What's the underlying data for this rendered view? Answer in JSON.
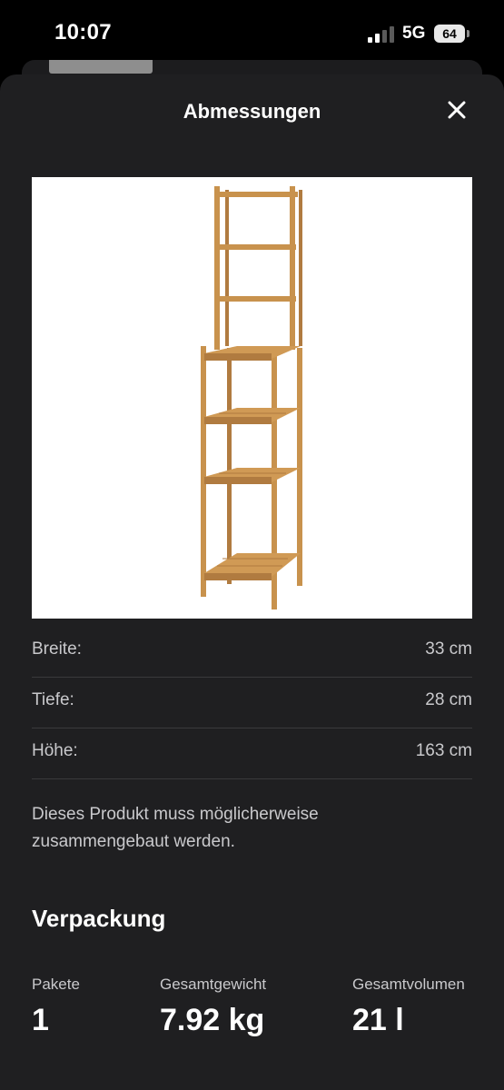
{
  "status_bar": {
    "time": "10:07",
    "network": "5G",
    "battery": "64",
    "signal_icon": "signal-bars-icon"
  },
  "sheet": {
    "title": "Abmessungen",
    "close_icon": "close-icon"
  },
  "product_image": {
    "subject": "shelf-unit-image",
    "colors": {
      "wood": "#c8924d",
      "wood_dark": "#a8733a"
    }
  },
  "dimensions": [
    {
      "label": "Breite:",
      "value": "33 cm"
    },
    {
      "label": "Tiefe:",
      "value": "28 cm"
    },
    {
      "label": "Höhe:",
      "value": "163 cm"
    }
  ],
  "assembly_note": "Dieses Produkt muss möglicherweise zusammengebaut werden.",
  "packaging": {
    "heading": "Verpackung",
    "items": [
      {
        "label": "Pakete",
        "value": "1"
      },
      {
        "label": "Gesamtgewicht",
        "value": "7.92 kg"
      },
      {
        "label": "Gesamtvolumen",
        "value": "21 l"
      }
    ]
  },
  "colors": {
    "background": "#000000",
    "sheet": "#1f1f21",
    "divider": "#3a3a3c",
    "text_primary": "#ffffff",
    "text_secondary": "#c9c9cc"
  }
}
